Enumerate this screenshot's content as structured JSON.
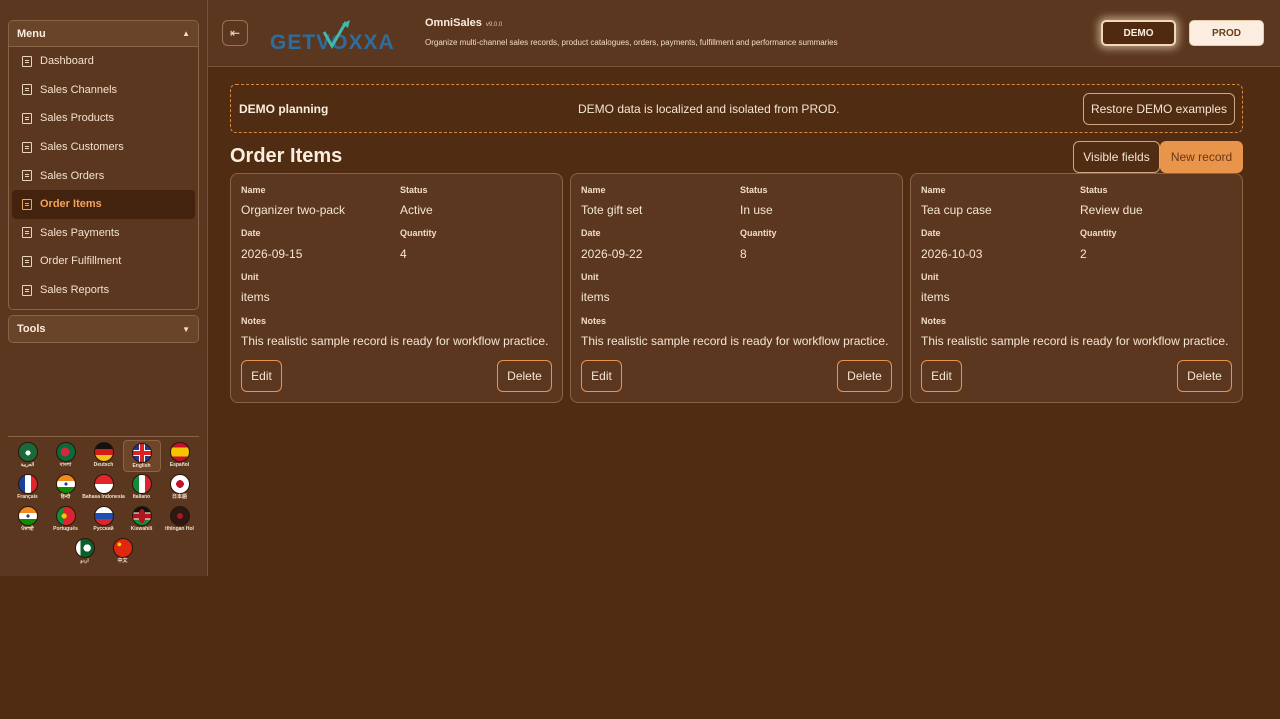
{
  "sidebar": {
    "menu_title": "Menu",
    "menu_items": [
      {
        "label": "Dashboard"
      },
      {
        "label": "Sales Channels"
      },
      {
        "label": "Sales Products"
      },
      {
        "label": "Sales Customers"
      },
      {
        "label": "Sales Orders"
      },
      {
        "label": "Order Items",
        "active": true
      },
      {
        "label": "Sales Payments"
      },
      {
        "label": "Order Fulfillment"
      },
      {
        "label": "Sales Reports"
      }
    ],
    "tools_title": "Tools",
    "languages": [
      {
        "name": "العربية",
        "flag": "saudi-arabia"
      },
      {
        "name": "বাংলা",
        "flag": "bangladesh"
      },
      {
        "name": "Deutsch",
        "flag": "germany"
      },
      {
        "name": "English",
        "flag": "united-kingdom",
        "selected": true
      },
      {
        "name": "Español",
        "flag": "spain"
      },
      {
        "name": "Français",
        "flag": "france"
      },
      {
        "name": "हिन्दी",
        "flag": "india"
      },
      {
        "name": "Bahasa Indonesia",
        "flag": "indonesia"
      },
      {
        "name": "Italiano",
        "flag": "italy"
      },
      {
        "name": "日本語",
        "flag": "japan"
      },
      {
        "name": "ਪੰਜਾਬੀ",
        "flag": "india"
      },
      {
        "name": "Português",
        "flag": "portugal"
      },
      {
        "name": "Русский",
        "flag": "russia"
      },
      {
        "name": "Kiswahili",
        "flag": "kenya"
      },
      {
        "name": "tlhIngan Hol",
        "flag": "klingon"
      },
      {
        "name": "اردو",
        "flag": "pakistan"
      },
      {
        "name": "中文",
        "flag": "china"
      }
    ]
  },
  "header": {
    "logo_text": "GETVOXXA",
    "app_name": "OmniSales",
    "version": "v9.0.0",
    "subtitle": "Organize multi-channel sales records, product catalogues, orders, payments, fulfillment and performance summaries",
    "env_demo": "DEMO",
    "env_prod": "PROD"
  },
  "banner": {
    "title": "DEMO planning",
    "message": "DEMO data is localized and isolated from PROD.",
    "restore_label": "Restore DEMO examples"
  },
  "page": {
    "title": "Order Items",
    "visible_fields_label": "Visible fields",
    "new_record_label": "New record"
  },
  "card_labels": {
    "name": "Name",
    "status": "Status",
    "date": "Date",
    "quantity": "Quantity",
    "unit": "Unit",
    "notes": "Notes",
    "edit": "Edit",
    "delete": "Delete"
  },
  "records": [
    {
      "name": "Organizer two-pack",
      "status": "Active",
      "date": "2026-09-15",
      "quantity": "4",
      "unit": "items",
      "notes": "This realistic sample record is ready for workflow practice."
    },
    {
      "name": "Tote gift set",
      "status": "In use",
      "date": "2026-09-22",
      "quantity": "8",
      "unit": "items",
      "notes": "This realistic sample record is ready for workflow practice."
    },
    {
      "name": "Tea cup case",
      "status": "Review due",
      "date": "2026-10-03",
      "quantity": "2",
      "unit": "items",
      "notes": "This realistic sample record is ready for workflow practice."
    }
  ],
  "colors": {
    "background": "#4f2c12",
    "panel": "#5b3720",
    "accent": "#e9944b",
    "active_text": "#f6a35a"
  }
}
